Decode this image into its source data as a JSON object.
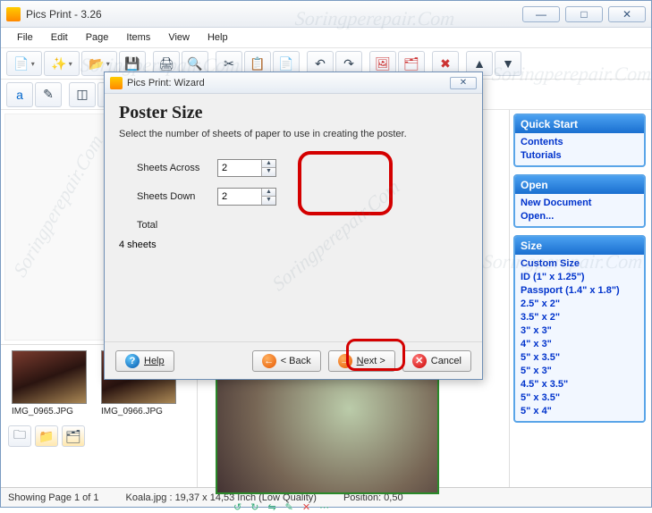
{
  "window": {
    "title": "Pics Print - 3.26",
    "min": "—",
    "max": "□",
    "close": "✕"
  },
  "menu": {
    "file": "File",
    "edit": "Edit",
    "page": "Page",
    "items": "Items",
    "view": "View",
    "help": "Help"
  },
  "dialog": {
    "title": "Pics Print: Wizard",
    "heading": "Poster Size",
    "desc": "Select the number of sheets of paper to use in creating the poster.",
    "labels": {
      "across": "Sheets Across",
      "down": "Sheets Down",
      "total": "Total"
    },
    "values": {
      "across": "2",
      "down": "2",
      "total": "4 sheets"
    },
    "buttons": {
      "help": "Help",
      "back": "< Back",
      "next": "Next >",
      "cancel": "Cancel"
    }
  },
  "thumbs": {
    "c1": "IMG_0965.JPG",
    "c2": "IMG_0966.JPG"
  },
  "panels": {
    "qs": {
      "title": "Quick Start",
      "items": [
        "Contents",
        "Tutorials"
      ]
    },
    "open": {
      "title": "Open",
      "items": [
        "New Document",
        "Open..."
      ]
    },
    "size": {
      "title": "Size",
      "items": [
        "Custom Size",
        "ID (1\" x 1.25\")",
        "Passport (1.4\" x 1.8\")",
        "2.5\" x 2\"",
        "3.5\" x 2\"",
        "3\" x 3\"",
        "4\" x 3\"",
        "5\" x 3.5\"",
        "5\" x 3\"",
        "4.5\" x 3.5\"",
        "5\" x 3.5\"",
        "5\" x 4\""
      ]
    }
  },
  "status": {
    "page": "Showing Page 1 of 1",
    "file": "Koala.jpg : 19,37 x 14,53 Inch (Low Quality)",
    "pos": "Position: 0,50"
  },
  "watermark": "Soringperepair.Com"
}
